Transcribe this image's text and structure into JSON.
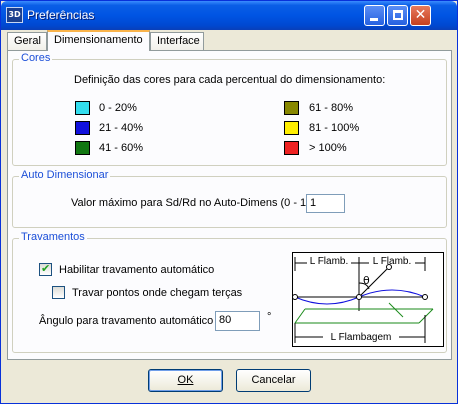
{
  "window": {
    "title": "Preferências",
    "app_icon_text": "3D"
  },
  "tabs": [
    {
      "label": "Geral"
    },
    {
      "label": "Dimensionamento"
    },
    {
      "label": "Interface"
    }
  ],
  "cores": {
    "legend": "Cores",
    "description": "Definição das cores para cada percentual do dimensionamento:",
    "ranges": [
      {
        "label": "0 - 20%",
        "color": "#33ddee"
      },
      {
        "label": "21 - 40%",
        "color": "#1111dd"
      },
      {
        "label": "41 - 60%",
        "color": "#117711"
      },
      {
        "label": "61 - 80%",
        "color": "#888800"
      },
      {
        "label": "81 - 100%",
        "color": "#ffee00"
      },
      {
        "label": "> 100%",
        "color": "#ee2222"
      }
    ]
  },
  "auto": {
    "legend": "Auto Dimensionar",
    "label": "Valor máximo para Sd/Rd no Auto-Dimens (0 - 1)",
    "value": "1"
  },
  "travamentos": {
    "legend": "Travamentos",
    "habilitar_label": "Habilitar travamento automático",
    "habilitar_checked": true,
    "tercas_label": "Travar pontos onde chegam terças",
    "tercas_checked": false,
    "angulo_label": "Ângulo para travamento automático",
    "angulo_value": "80",
    "angulo_unit": "°",
    "diagram": {
      "label_flamb_left": "L Flamb.",
      "label_flamb_right": "L Flamb.",
      "label_theta": "θ",
      "label_flambagem": "L Flambagem"
    }
  },
  "buttons": {
    "ok": "OK",
    "cancel": "Cancelar"
  }
}
